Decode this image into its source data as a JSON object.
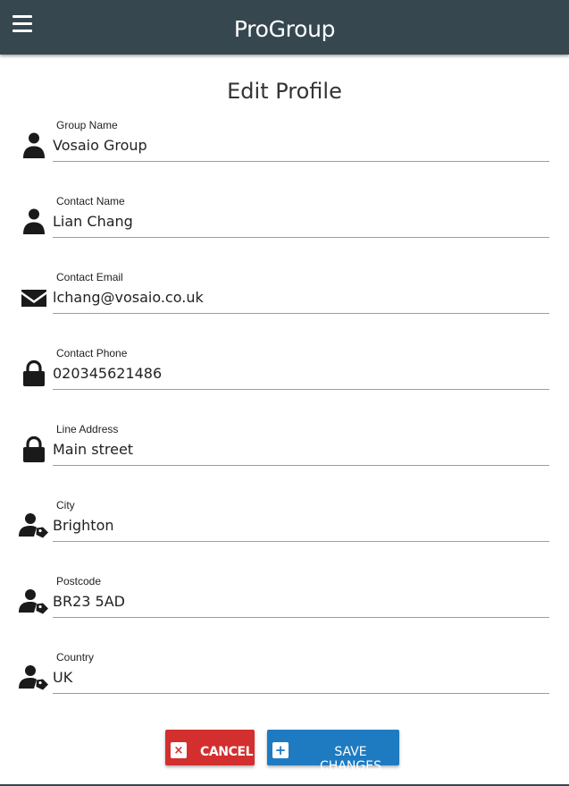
{
  "app": {
    "title": "ProGroup"
  },
  "page": {
    "title": "Edit Profile"
  },
  "fields": [
    {
      "label": "Group Name",
      "value": "Vosaio Group",
      "icon": "person-icon"
    },
    {
      "label": "Contact Name",
      "value": "Lian Chang",
      "icon": "person-icon"
    },
    {
      "label": "Contact Email",
      "value": "lchang@vosaio.co.uk",
      "icon": "envelope-icon"
    },
    {
      "label": "Contact Phone",
      "value": "020345621486",
      "icon": "lock-icon"
    },
    {
      "label": "Line Address",
      "value": "Main street",
      "icon": "lock-icon"
    },
    {
      "label": "City",
      "value": "Brighton",
      "icon": "person-tag-icon"
    },
    {
      "label": "Postcode",
      "value": "BR23 5AD",
      "icon": "person-tag-icon"
    },
    {
      "label": "Country",
      "value": "UK",
      "icon": "person-tag-icon"
    }
  ],
  "actions": {
    "cancel_label": "CANCEL",
    "cancel_icon_glyph": "×",
    "save_label": "SAVE CHANGES",
    "save_icon_glyph": "+"
  },
  "colors": {
    "header": "#36474f",
    "cancel": "#d32f2f",
    "save": "#1e7bc1"
  }
}
